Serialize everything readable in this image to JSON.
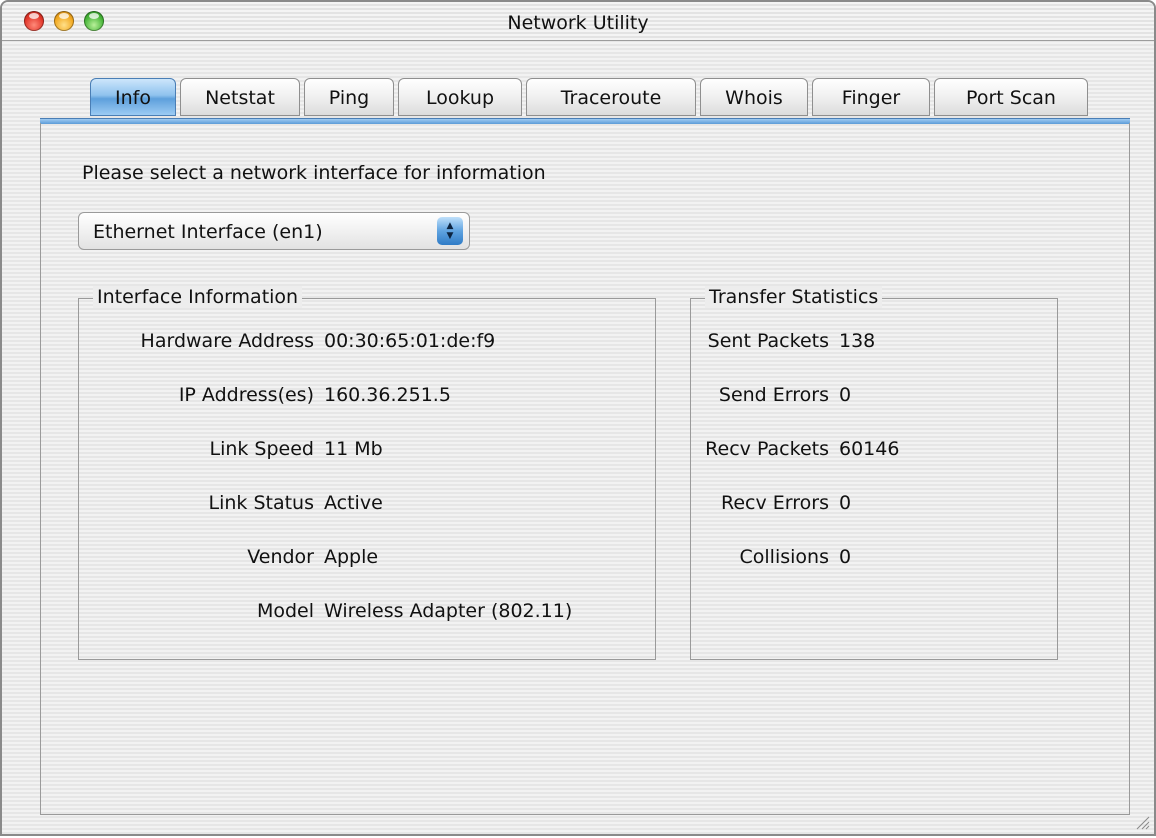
{
  "window": {
    "title": "Network Utility"
  },
  "tabs": [
    {
      "label": "Info"
    },
    {
      "label": "Netstat"
    },
    {
      "label": "Ping"
    },
    {
      "label": "Lookup"
    },
    {
      "label": "Traceroute"
    },
    {
      "label": "Whois"
    },
    {
      "label": "Finger"
    },
    {
      "label": "Port Scan"
    }
  ],
  "selected_tab": "Info",
  "info": {
    "prompt": "Please select a network interface for information",
    "interface_select": {
      "value": "Ethernet Interface (en1)"
    },
    "interface_information": {
      "title": "Interface Information",
      "rows": [
        {
          "label": "Hardware Address",
          "value": "00:30:65:01:de:f9"
        },
        {
          "label": "IP Address(es)",
          "value": "160.36.251.5"
        },
        {
          "label": "Link Speed",
          "value": "11 Mb"
        },
        {
          "label": "Link Status",
          "value": "Active"
        },
        {
          "label": "Vendor",
          "value": "Apple"
        },
        {
          "label": "Model",
          "value": "Wireless Adapter (802.11)"
        }
      ]
    },
    "transfer_statistics": {
      "title": "Transfer Statistics",
      "rows": [
        {
          "label": "Sent Packets",
          "value": "138"
        },
        {
          "label": "Send Errors",
          "value": "0"
        },
        {
          "label": "Recv Packets",
          "value": "60146"
        },
        {
          "label": "Recv Errors",
          "value": "0"
        },
        {
          "label": "Collisions",
          "value": "0"
        }
      ]
    }
  },
  "colors": {
    "active_tab": "#5ea0dc",
    "tab_underline": "#5b9bd8",
    "close_button": "#e2372b",
    "minimize_button": "#f2a921",
    "zoom_button": "#49b63a"
  },
  "icons": {
    "close": "close-icon",
    "minimize": "minimize-icon",
    "zoom": "zoom-icon",
    "popup_arrows": "updown-arrows-icon",
    "resize": "resize-grip-icon"
  }
}
